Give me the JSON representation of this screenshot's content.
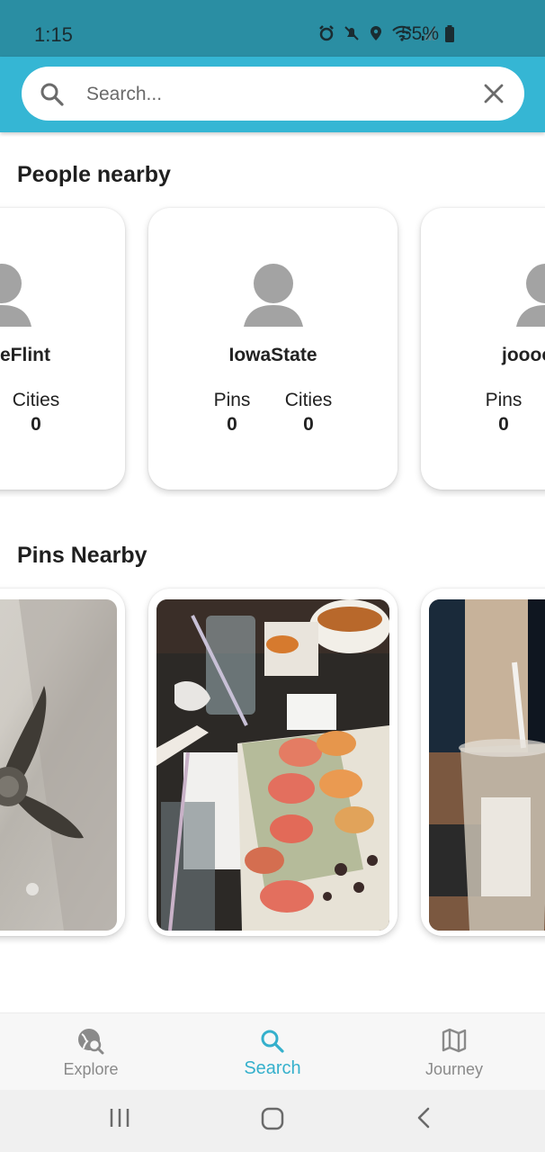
{
  "status_bar": {
    "time": "1:15",
    "battery": "55%"
  },
  "search": {
    "placeholder": "Search..."
  },
  "people_section": {
    "title": "People nearby",
    "cards": [
      {
        "name": "eFlint",
        "stats": [
          {
            "label": "Cities",
            "value": "0"
          }
        ]
      },
      {
        "name": "IowaState",
        "stats": [
          {
            "label": "Pins",
            "value": "0"
          },
          {
            "label": "Cities",
            "value": "0"
          }
        ]
      },
      {
        "name": "joooo",
        "stats": [
          {
            "label": "Pins",
            "value": "0"
          }
        ]
      }
    ]
  },
  "pins_section": {
    "title": "Pins Nearby"
  },
  "bottom_nav": {
    "items": [
      {
        "label": "Explore",
        "icon": "globe-search-icon",
        "active": false
      },
      {
        "label": "Search",
        "icon": "search-icon",
        "active": true
      },
      {
        "label": "Journey",
        "icon": "map-icon",
        "active": false
      }
    ]
  },
  "colors": {
    "header": "#35b6d4",
    "status_bar": "#2a8ea3",
    "active_nav": "#35b0cc"
  }
}
